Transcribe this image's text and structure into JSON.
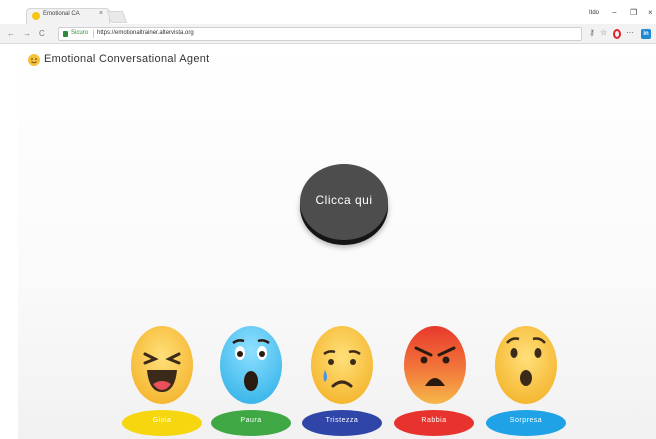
{
  "browser": {
    "tab_title": "Emotional CA",
    "tab_close": "×",
    "user_label": "Itdo",
    "window_controls": {
      "minimize": "−",
      "restore": "❐",
      "close": "×"
    },
    "nav": {
      "back": "←",
      "forward": "→",
      "reload": "C"
    },
    "secure_label": "Sicuro",
    "url": "https://emotionaltrainer.altervista.org",
    "toolbar_icons": {
      "key": "⚷",
      "star": "☆",
      "more": "⋯",
      "linkedin": "in"
    }
  },
  "app": {
    "title": "Emotional Conversational Agent",
    "logo_icon": "smiley-icon"
  },
  "main_button": {
    "label": "Clicca qui",
    "color": "#4d4d4d"
  },
  "emotions": [
    {
      "label": "Gioia",
      "icon": "laughing-face-icon",
      "pill_color": "#f5d60f"
    },
    {
      "label": "Paura",
      "icon": "fearful-face-icon",
      "pill_color": "#3fa845"
    },
    {
      "label": "Tristezza",
      "icon": "crying-face-icon",
      "pill_color": "#2f46a8"
    },
    {
      "label": "Rabbia",
      "icon": "angry-face-icon",
      "pill_color": "#e8322e"
    },
    {
      "label": "Sorpresa",
      "icon": "surprised-face-icon",
      "pill_color": "#20a3e6"
    }
  ]
}
